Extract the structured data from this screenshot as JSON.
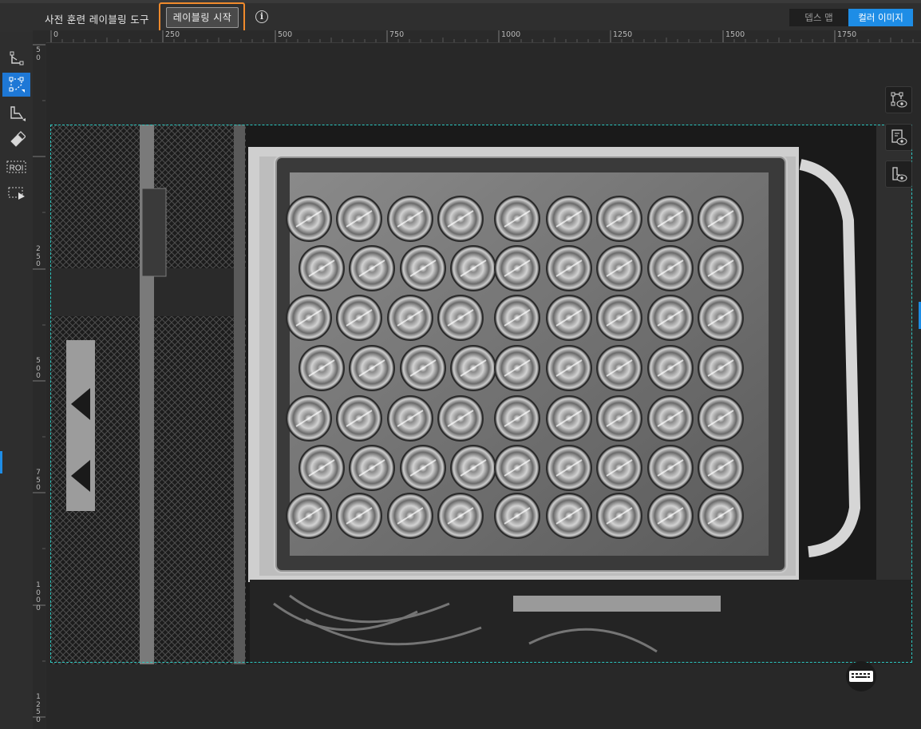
{
  "toolbar": {
    "title": "사전 훈련 레이블링 도구",
    "start_button": "레이블링 시작",
    "info_icon": "i",
    "view_tabs": [
      {
        "label": "뎁스 맵",
        "active": false
      },
      {
        "label": "컬러 이미지",
        "active": true
      }
    ]
  },
  "ruler": {
    "top_ticks": [
      "0",
      "250",
      "500",
      "750",
      "1000",
      "1250",
      "1500",
      "1750"
    ],
    "left_ticks": [
      "250",
      "500",
      "750",
      "1000",
      "1250"
    ]
  },
  "left_tools": [
    {
      "icon": "polygon-point-icon",
      "active": false
    },
    {
      "icon": "polygon-select-icon",
      "active": true
    },
    {
      "icon": "draw-shape-icon",
      "active": false
    },
    {
      "icon": "eraser-icon",
      "active": false
    },
    {
      "icon": "roi-icon",
      "label": "ROI",
      "active": false
    },
    {
      "icon": "roi-play-icon",
      "active": false
    }
  ],
  "right_tools": [
    {
      "icon": "show-polygon-icon"
    },
    {
      "icon": "show-labels-icon"
    },
    {
      "icon": "show-shape-icon"
    }
  ],
  "keyboard_icon": "keyboard-icon",
  "colors": {
    "accent": "#1e8de6",
    "highlight": "#f08a2c",
    "roi": "#2cc7c0"
  }
}
